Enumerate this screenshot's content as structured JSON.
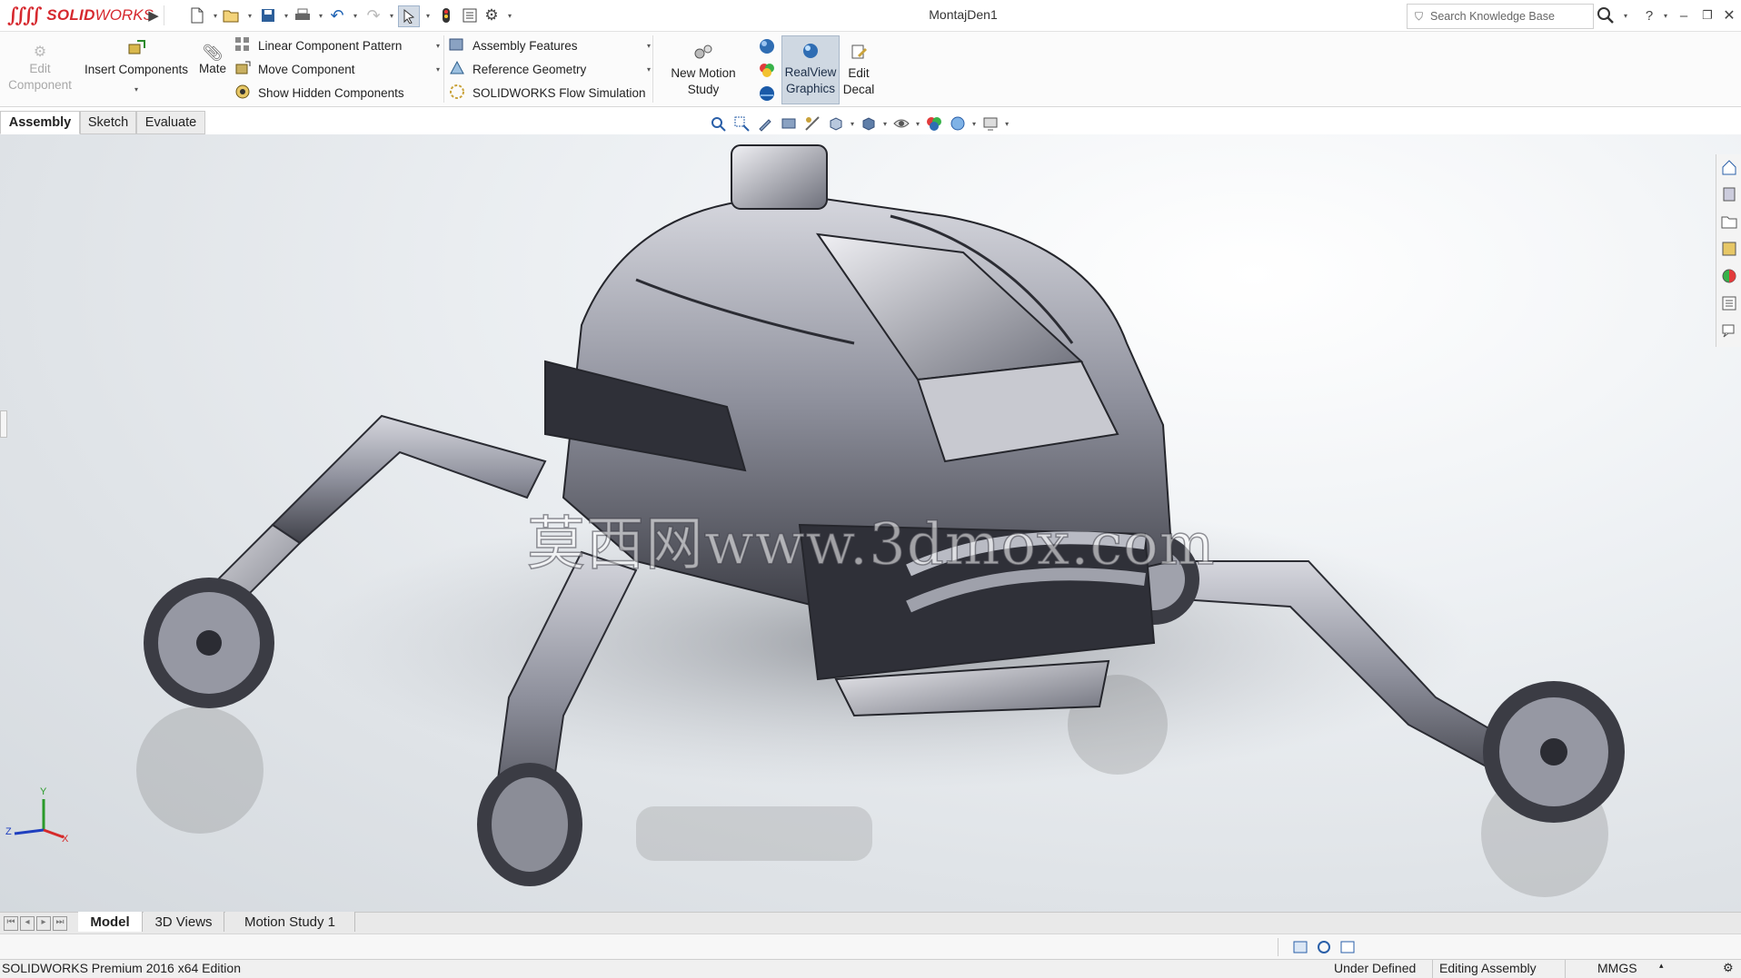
{
  "app": {
    "logo_text_brand": "SOLID",
    "logo_text_suffix": "WORKS",
    "document_title": "MontajDen1"
  },
  "search": {
    "placeholder": "Search Knowledge Base"
  },
  "ribbon": {
    "edit_component": "Edit\nComponent",
    "insert_components": "Insert Components",
    "mate": "Mate",
    "linear_component_pattern": "Linear Component Pattern",
    "move_component": "Move Component",
    "show_hidden_components": "Show Hidden Components",
    "assembly_features": "Assembly Features",
    "reference_geometry": "Reference Geometry",
    "flow_simulation": "SOLIDWORKS Flow Simulation",
    "new_motion_study": "New Motion\nStudy",
    "realview_graphics": "RealView\nGraphics",
    "edit_decal": "Edit\nDecal"
  },
  "command_tabs": [
    {
      "label": "Assembly",
      "active": true
    },
    {
      "label": "Sketch",
      "active": false
    },
    {
      "label": "Evaluate",
      "active": false
    }
  ],
  "viewport": {
    "watermark": "莫西网www.3dmox.com",
    "triad": {
      "y": "Y",
      "z": "Z",
      "x": "X"
    }
  },
  "bottom_tabs": [
    {
      "label": "Model",
      "active": true
    },
    {
      "label": "3D Views",
      "active": false
    },
    {
      "label": "Motion Study 1",
      "active": false
    }
  ],
  "status_bar": {
    "edition": "SOLIDWORKS Premium 2016 x64 Edition",
    "definition_state": "Under Defined",
    "mode": "Editing Assembly",
    "units": "MMGS"
  },
  "colors": {
    "brand": "#d6282e",
    "accent": "#1f63b4",
    "active_button": "#cfd8e2"
  },
  "icons": [
    "new-icon",
    "open-icon",
    "save-icon",
    "print-icon",
    "undo-icon",
    "redo-icon",
    "select-icon",
    "help-icon",
    "minimize-icon",
    "restore-icon",
    "close-icon",
    "search-icon"
  ]
}
